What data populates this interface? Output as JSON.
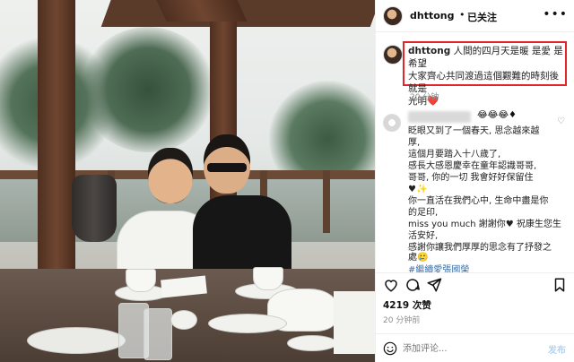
{
  "post": {
    "username": "dhttong",
    "follow_dot": "•",
    "follow_status": "已关注",
    "more_label": "•••"
  },
  "caption": {
    "username": "dhttong",
    "line1": " 人間的四月天是暖 是愛 是希望",
    "line2": "大家齊心共同渡過這個艱難的時刻後就是",
    "line3": "光明",
    "heart": "❤️",
    "time": "20 分钟"
  },
  "comment": {
    "emoji": "😂😂😂♦",
    "lines": [
      "眨眼又到了一個春天, 思念越來越",
      "厚,",
      "這個月要踏入十八歲了,",
      "感長大感恩慶幸在童年認識哥哥,",
      "哥哥, 你的一切 我會好好保留住",
      "♥✨",
      "你一直活在我們心中, 生命中盡是你",
      "的足印,",
      "miss you much 謝謝你♥ 祝康生您生",
      "活安好,",
      "感謝你讓我們厚厚的思念有了抒發之",
      "處🥲"
    ],
    "tags": "#繼續愛張國榮"
  },
  "stats": {
    "likes": "4219 次赞",
    "time": "20 分钟前"
  },
  "compose": {
    "placeholder": "添加评论...",
    "post_label": "发布"
  }
}
